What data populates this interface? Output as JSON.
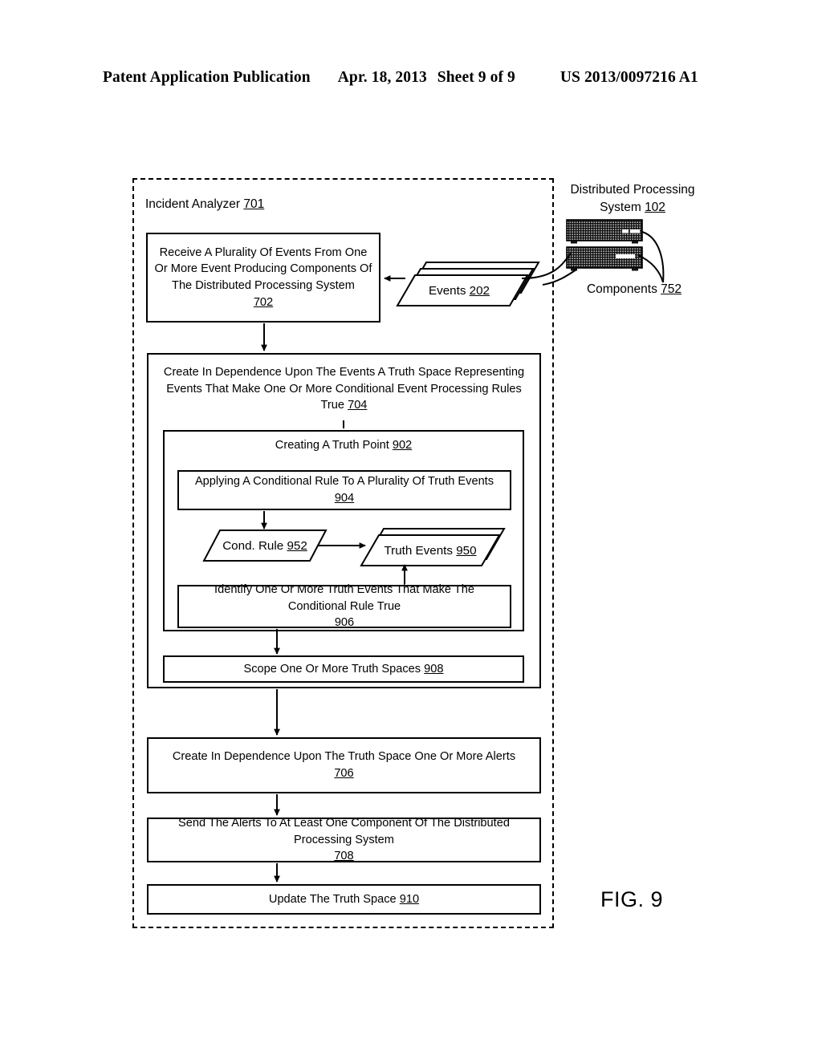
{
  "header": {
    "publication": "Patent Application Publication",
    "date": "Apr. 18, 2013",
    "sheet": "Sheet 9 of 9",
    "patent_number": "US 2013/0097216 A1"
  },
  "figure": {
    "label": "FIG. 9"
  },
  "diagram": {
    "incident_analyzer": {
      "label": "Incident Analyzer",
      "ref": "701"
    },
    "distributed_processing_system": {
      "line1": "Distributed Processing",
      "line2": "System",
      "ref": "102",
      "components_label": "Components",
      "components_ref": "752"
    },
    "blocks": [
      {
        "id": "702",
        "text": "Receive A Plurality Of Events From One Or More Event Producing Components Of The Distributed Processing System",
        "ref": "702"
      },
      {
        "id": "704",
        "text": "Create In Dependence Upon The Events A Truth Space Representing Events That Make One Or More Conditional Event Processing Rules True",
        "ref": "704"
      },
      {
        "id": "902",
        "text": "Creating A Truth Point",
        "ref": "902"
      },
      {
        "id": "904",
        "text": "Applying A Conditional Rule To A Plurality Of Truth Events",
        "ref": "904"
      },
      {
        "id": "906",
        "text": "Identify One Or More Truth Events That Make The Conditional Rule True",
        "ref": "906"
      },
      {
        "id": "908",
        "text": "Scope One Or More Truth Spaces",
        "ref": "908"
      },
      {
        "id": "706",
        "text": "Create In Dependence Upon The Truth Space One Or More Alerts",
        "ref": "706"
      },
      {
        "id": "708",
        "text": "Send The Alerts To At Least One Component Of The Distributed Processing System",
        "ref": "708"
      },
      {
        "id": "910",
        "text": "Update The Truth Space",
        "ref": "910"
      }
    ],
    "data_objects": [
      {
        "id": "events",
        "label": "Events",
        "ref": "202"
      },
      {
        "id": "cond_rule",
        "label": "Cond. Rule",
        "ref": "952"
      },
      {
        "id": "truth_events",
        "label": "Truth Events",
        "ref": "950"
      }
    ]
  },
  "colors": {
    "ink": "#000000",
    "paper": "#ffffff"
  }
}
